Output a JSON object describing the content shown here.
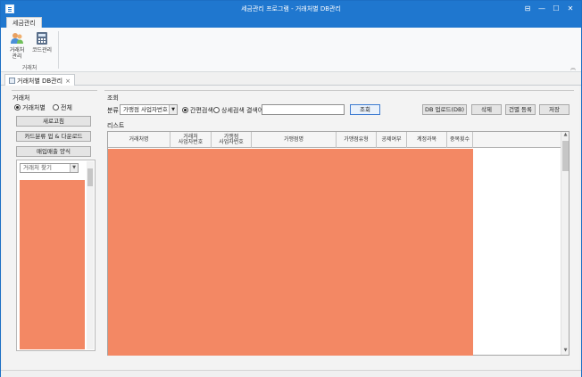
{
  "window": {
    "title": "세금관리 프로그램 - 거래처별 DB관리",
    "controls": {
      "pin": "⊟",
      "minimize": "—",
      "maximize": "☐",
      "close": "✕"
    }
  },
  "ribbon": {
    "tab": "세금관리",
    "buttons": [
      {
        "label": "거래처\n관리",
        "icon": "people-icon"
      },
      {
        "label": "코드관리",
        "icon": "calculator-icon"
      }
    ],
    "group_label": "거래처",
    "collapse_icon": "collapse-ribbon-icon"
  },
  "doc_tab": {
    "label": "거래처별 DB관리",
    "close": "×"
  },
  "left_panel": {
    "title": "거래처",
    "radio_options": [
      {
        "label": "거래처별",
        "checked": true
      },
      {
        "label": "전체",
        "checked": false
      }
    ],
    "buttons": [
      "새로고침",
      "카드분류 업 & 다운로드",
      "매입매출 양식"
    ],
    "search_combo": "거래처 찾기"
  },
  "search": {
    "title": "조회",
    "category_label": "분류",
    "category_value": "가맹점 사업자번호",
    "radio_simple": "간편검색",
    "radio_detail": "상세검색 결색어",
    "query_value": "",
    "search_button": "조회",
    "actions": [
      "DB 업로드(DB)",
      "삭제",
      "건별 등록",
      "저장"
    ]
  },
  "list": {
    "title": "리스트",
    "columns": [
      "거래처명",
      "거래처\n사업자번호",
      "가맹점\n사업자번호",
      "가맹점명",
      "가맹점유형",
      "공제여부",
      "계정과목",
      "중복횟수"
    ]
  }
}
